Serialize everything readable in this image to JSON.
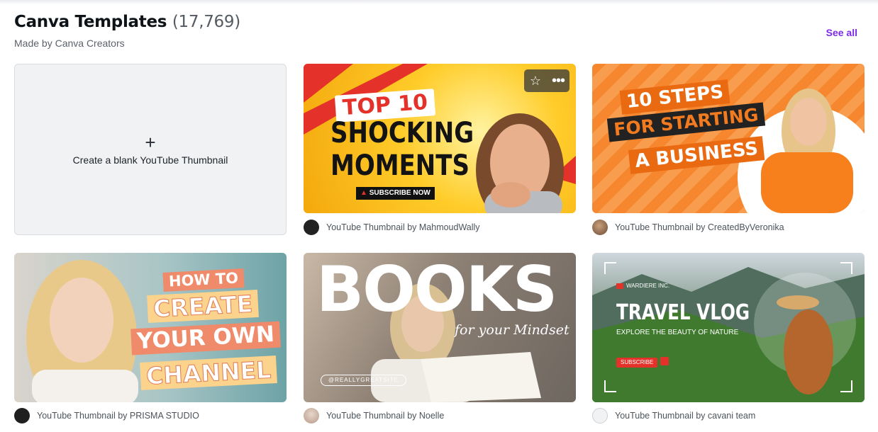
{
  "header": {
    "title": "Canva Templates",
    "count": "(17,769)",
    "subtitle": "Made by Canva Creators",
    "see_all": "See all"
  },
  "blank_card": {
    "icon": "plus-icon",
    "label": "Create a blank YouTube Thumbnail"
  },
  "templates": [
    {
      "credit": "YouTube Thumbnail by MahmoudWally",
      "lines": [
        "TOP 10",
        "SHOCKING",
        "MOMENTS",
        "SUBSCRIBE NOW"
      ]
    },
    {
      "credit": "YouTube Thumbnail by CreatedByVeronika",
      "lines": [
        "10 STEPS",
        "FOR STARTING",
        "A BUSINESS"
      ]
    },
    {
      "credit": "YouTube Thumbnail by PRISMA STUDIO",
      "lines": [
        "HOW TO",
        "CREATE",
        "YOUR OWN",
        "CHANNEL"
      ]
    },
    {
      "credit": "YouTube Thumbnail by Noelle",
      "lines": [
        "BOOKS",
        "for your Mindset",
        "@REALLYGREATSITE"
      ]
    },
    {
      "credit": "YouTube Thumbnail by cavani team",
      "lines": [
        "WARDIERE INC.",
        "TRAVEL VLOG",
        "EXPLORE THE BEAUTY OF NATURE",
        "SUBSCRIBE"
      ]
    }
  ],
  "colors": {
    "accent": "#7d2ae8",
    "muted_text": "#5b626b"
  }
}
